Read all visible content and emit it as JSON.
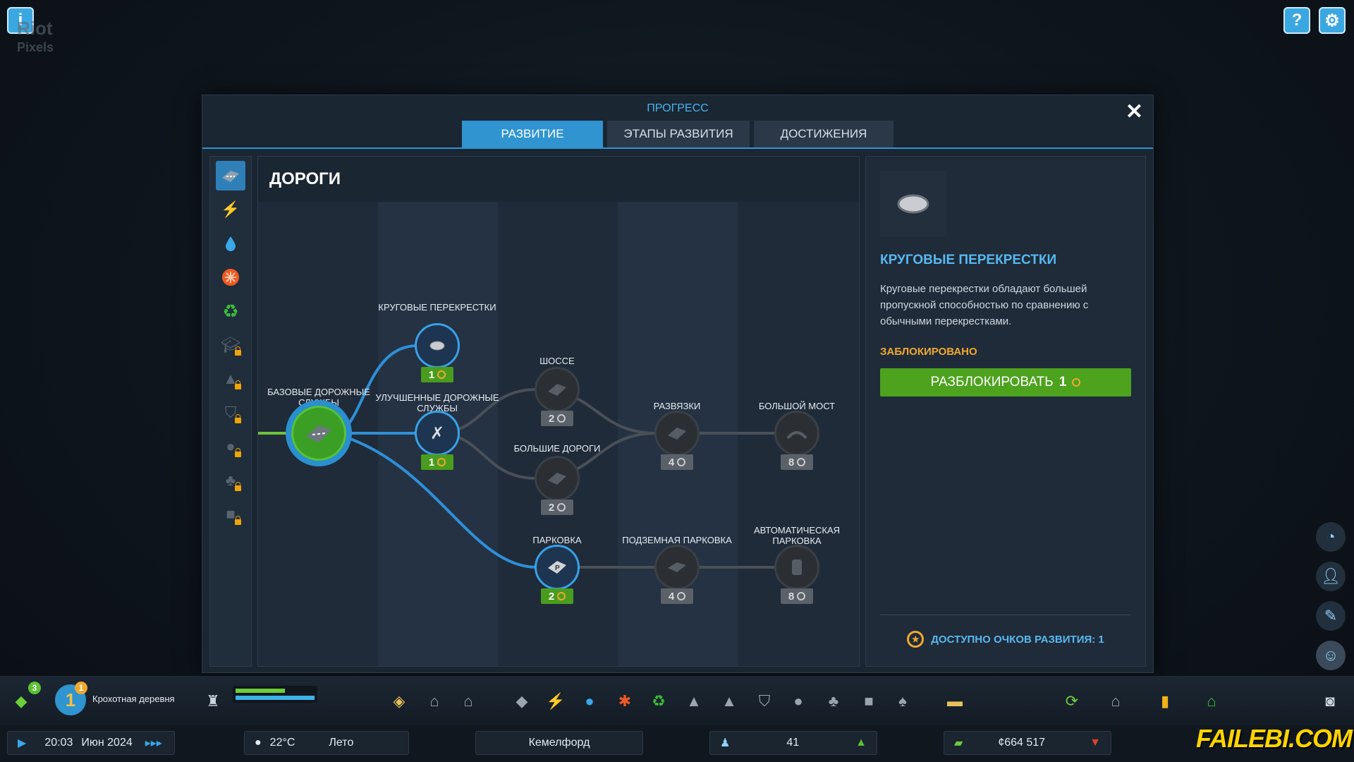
{
  "watermark_logo": "Riot Pixels",
  "panel": {
    "title": "ПРОГРЕСС",
    "close": "✕",
    "tabs": [
      {
        "label": "РАЗВИТИЕ",
        "active": true
      },
      {
        "label": "ЭТАПЫ РАЗВИТИЯ",
        "active": false
      },
      {
        "label": "ДОСТИЖЕНИЯ",
        "active": false
      }
    ]
  },
  "categories": [
    {
      "icon": "road-icon",
      "active": true
    },
    {
      "icon": "lightning-icon"
    },
    {
      "icon": "water-drop-icon"
    },
    {
      "icon": "medical-icon"
    },
    {
      "icon": "recycle-icon"
    },
    {
      "icon": "education-icon",
      "locked": true
    },
    {
      "icon": "police-icon",
      "locked": true
    },
    {
      "icon": "shield-icon",
      "locked": true
    },
    {
      "icon": "helmet-icon",
      "locked": true
    },
    {
      "icon": "tree-icon",
      "locked": true
    },
    {
      "icon": "bus-icon",
      "locked": true
    }
  ],
  "tree": {
    "title": "ДОРОГИ",
    "nodes": {
      "base": {
        "label": "БАЗОВЫЕ ДОРОЖНЫЕ СЛУЖБЫ",
        "state": "unlocked"
      },
      "roundabouts": {
        "label": "КРУГОВЫЕ ПЕРЕКРЕСТКИ",
        "cost": "1",
        "state": "available"
      },
      "improved": {
        "label": "УЛУЧШЕННЫЕ ДОРОЖНЫЕ СЛУЖБЫ",
        "cost": "1",
        "state": "available"
      },
      "highway": {
        "label": "ШОССЕ",
        "cost": "2",
        "state": "locked"
      },
      "big_roads": {
        "label": "БОЛЬШИЕ ДОРОГИ",
        "cost": "2",
        "state": "locked"
      },
      "interchanges": {
        "label": "РАЗВЯЗКИ",
        "cost": "4",
        "state": "locked"
      },
      "big_bridge": {
        "label": "БОЛЬШОЙ МОСТ",
        "cost": "8",
        "state": "locked"
      },
      "parking": {
        "label": "ПАРКОВКА",
        "cost": "2",
        "state": "available"
      },
      "underground_parking": {
        "label": "ПОДЗЕМНАЯ ПАРКОВКА",
        "cost": "4",
        "state": "locked"
      },
      "auto_parking": {
        "label": "АВТОМАТИЧЕСКАЯ ПАРКОВКА",
        "cost": "8",
        "state": "locked"
      }
    }
  },
  "detail": {
    "title": "КРУГОВЫЕ ПЕРЕКРЕСТКИ",
    "description": "Круговые перекрестки обладают большей пропускной способностью по сравнению с обычными перекрестками.",
    "status": "ЗАБЛОКИРОВАНО",
    "unlock_label": "РАЗБЛОКИРОВАТЬ",
    "unlock_cost": "1",
    "points_text": "ДОСТУПНО ОЧКОВ РАЗВИТИЯ: 1"
  },
  "bottom": {
    "progress_badge": "3",
    "level": "1",
    "level_badge": "1",
    "settlement": "Крохотная деревня",
    "time": "20:03",
    "date": "Июн 2024",
    "temperature": "22°C",
    "season": "Лето",
    "city": "Кемелфорд",
    "population": "41",
    "money": "¢664 517"
  },
  "watermark_site": "FAILEBI.COM",
  "colors": {
    "accent": "#2f94d0",
    "green": "#4da21e",
    "warning": "#f0a830"
  }
}
